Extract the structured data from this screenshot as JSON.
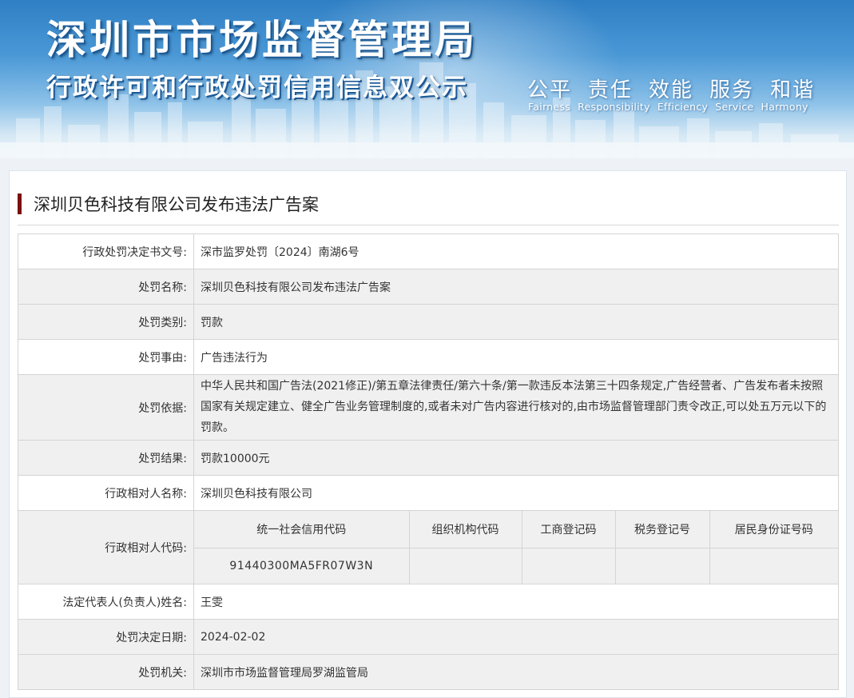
{
  "banner": {
    "title_main": "深圳市市场监督管理局",
    "title_sub": "行政许可和行政处罚信用信息双公示",
    "slogan_cn": [
      "公平",
      "责任",
      "效能",
      "服务",
      "和谐"
    ],
    "slogan_en": [
      "Fairness",
      "Responsibility",
      "Efficiency",
      "Service",
      "Harmony"
    ]
  },
  "case": {
    "title": "深圳贝色科技有限公司发布违法广告案"
  },
  "rows": {
    "decision_no": {
      "label": "行政处罚决定书文号:",
      "value": "深市监罗处罚〔2024〕南湖6号"
    },
    "penalty_name": {
      "label": "处罚名称:",
      "value": "深圳贝色科技有限公司发布违法广告案"
    },
    "penalty_type": {
      "label": "处罚类别:",
      "value": "罚款"
    },
    "penalty_reason": {
      "label": "处罚事由:",
      "value": "广告违法行为"
    },
    "penalty_basis": {
      "label": "处罚依据:",
      "value": "中华人民共和国广告法(2021修正)/第五章法律责任/第六十条/第一款违反本法第三十四条规定,广告经营者、广告发布者未按照国家有关规定建立、健全广告业务管理制度的,或者未对广告内容进行核对的,由市场监督管理部门责令改正,可以处五万元以下的罚款。"
    },
    "penalty_result": {
      "label": "处罚结果:",
      "value": "罚款10000元"
    },
    "party_name": {
      "label": "行政相对人名称:",
      "value": "深圳贝色科技有限公司"
    },
    "party_code": {
      "label": "行政相对人代码:",
      "headers": [
        "统一社会信用代码",
        "组织机构代码",
        "工商登记码",
        "税务登记号",
        "居民身份证号码"
      ],
      "values": [
        "91440300MA5FR07W3N",
        "",
        "",
        "",
        ""
      ]
    },
    "legal_rep": {
      "label": "法定代表人(负责人)姓名:",
      "value": "王雯"
    },
    "decision_date": {
      "label": "处罚决定日期:",
      "value": "2024-02-02"
    },
    "authority": {
      "label": "处罚机关:",
      "value": "深圳市市场监督管理局罗湖监管局"
    }
  }
}
